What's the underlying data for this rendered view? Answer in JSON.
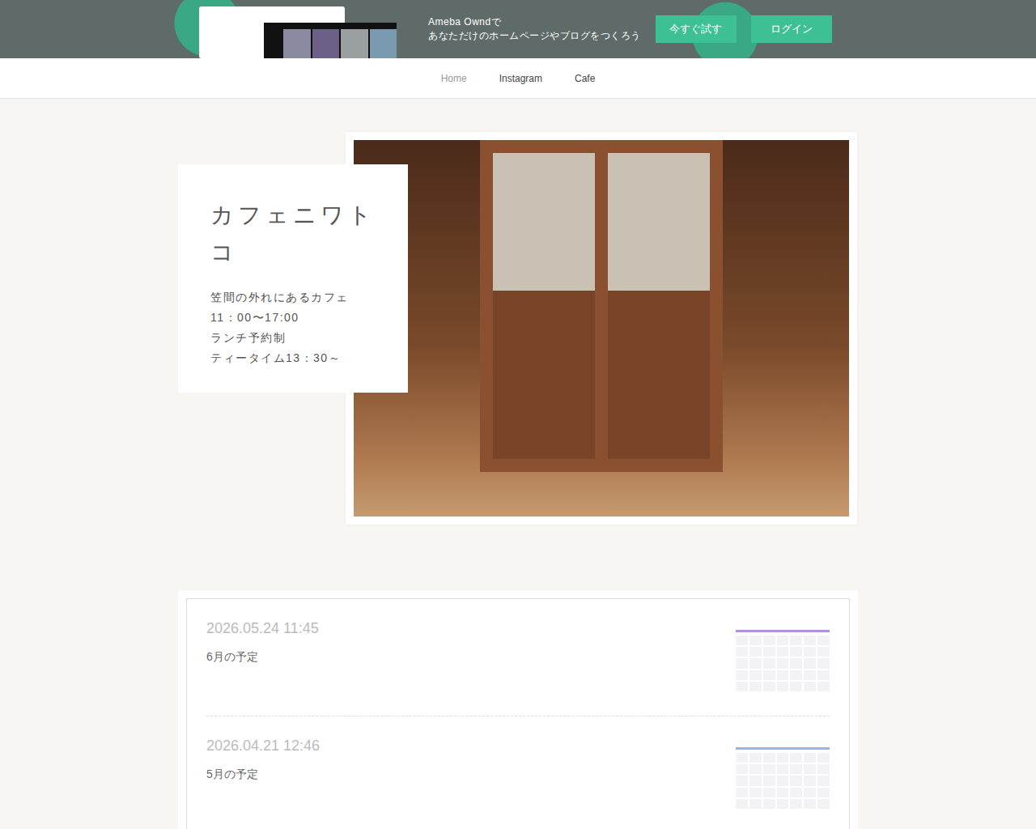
{
  "banner": {
    "lines": [
      "Ameba Owndで",
      "あなただけのホームページやブログをつくろう"
    ],
    "buttons": [
      "今すぐ試す",
      "ログイン"
    ]
  },
  "nav": [
    {
      "label": "Home",
      "selected": true
    },
    {
      "label": "Instagram",
      "selected": false
    },
    {
      "label": "Cafe",
      "selected": false
    }
  ],
  "hero": {
    "title": "カフェニワトコ",
    "lines": [
      "笠間の外れにあるカフェ",
      "11：00〜17:00",
      "ランチ予約制",
      "ティータイム13：30～"
    ]
  },
  "posts": [
    {
      "date": "2026.05.24 11:45",
      "title": "6月の予定",
      "color": "#b48fe0"
    },
    {
      "date": "2026.04.21 12:46",
      "title": "5月の予定",
      "color": "#8fb8e6"
    }
  ]
}
